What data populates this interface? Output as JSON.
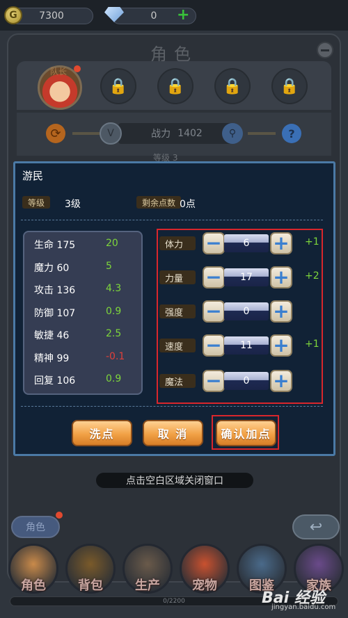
{
  "topbar": {
    "gold": "7300",
    "gems": "0",
    "coin_glyph": "G",
    "plus_glyph": "+"
  },
  "background": {
    "title": "角色",
    "captain_label": "队长",
    "lock_glyph": "🔒",
    "power_label": "战力",
    "power_value": "1402",
    "level_peek": "等级 3",
    "refresh_glyph": "⟳",
    "search_glyph": "⚲",
    "help_glyph": "?",
    "close_hint": "点击空白区域关闭窗口",
    "role_tab": "角色",
    "back_glyph": "↩",
    "xp_text": "0/2200"
  },
  "bottom_nav": [
    {
      "label": "角色",
      "color": "#c98a4a"
    },
    {
      "label": "背包",
      "color": "#7a5a2a"
    },
    {
      "label": "生产",
      "color": "#6a5a4a"
    },
    {
      "label": "宠物",
      "color": "#c9512f"
    },
    {
      "label": "图鉴",
      "color": "#4a6a8a"
    },
    {
      "label": "家族",
      "color": "#6a4a8a"
    }
  ],
  "watermark": {
    "logo": "Bai 经验",
    "url": "jingyan.baidu.com"
  },
  "dialog": {
    "title": "游民",
    "level_tag": "等级",
    "level_value": "3级",
    "points_tag": "剩余点数",
    "points_value": "0点",
    "stats": [
      {
        "label": "生命 175",
        "value": "20",
        "color": "#7ed63b"
      },
      {
        "label": "魔力 60",
        "value": "5",
        "color": "#7ed63b"
      },
      {
        "label": "攻击 136",
        "value": "4.3",
        "color": "#7ed63b"
      },
      {
        "label": "防御 107",
        "value": "0.9",
        "color": "#7ed63b"
      },
      {
        "label": "敏捷 46",
        "value": "2.5",
        "color": "#7ed63b"
      },
      {
        "label": "精神 99",
        "value": "-0.1",
        "color": "#e0403a"
      },
      {
        "label": "回复 106",
        "value": "0.9",
        "color": "#7ed63b"
      }
    ],
    "attributes": [
      {
        "name": "体力",
        "value": "6",
        "bonus": "+1"
      },
      {
        "name": "力量",
        "value": "17",
        "bonus": "+2"
      },
      {
        "name": "强度",
        "value": "0",
        "bonus": ""
      },
      {
        "name": "速度",
        "value": "11",
        "bonus": "+1"
      },
      {
        "name": "魔法",
        "value": "0",
        "bonus": ""
      }
    ],
    "minus_glyph": "−",
    "plus_glyph": "+",
    "buttons": {
      "reset": "洗点",
      "cancel": "取 消",
      "confirm": "确认加点"
    }
  },
  "highlight_color": "#d9262c"
}
